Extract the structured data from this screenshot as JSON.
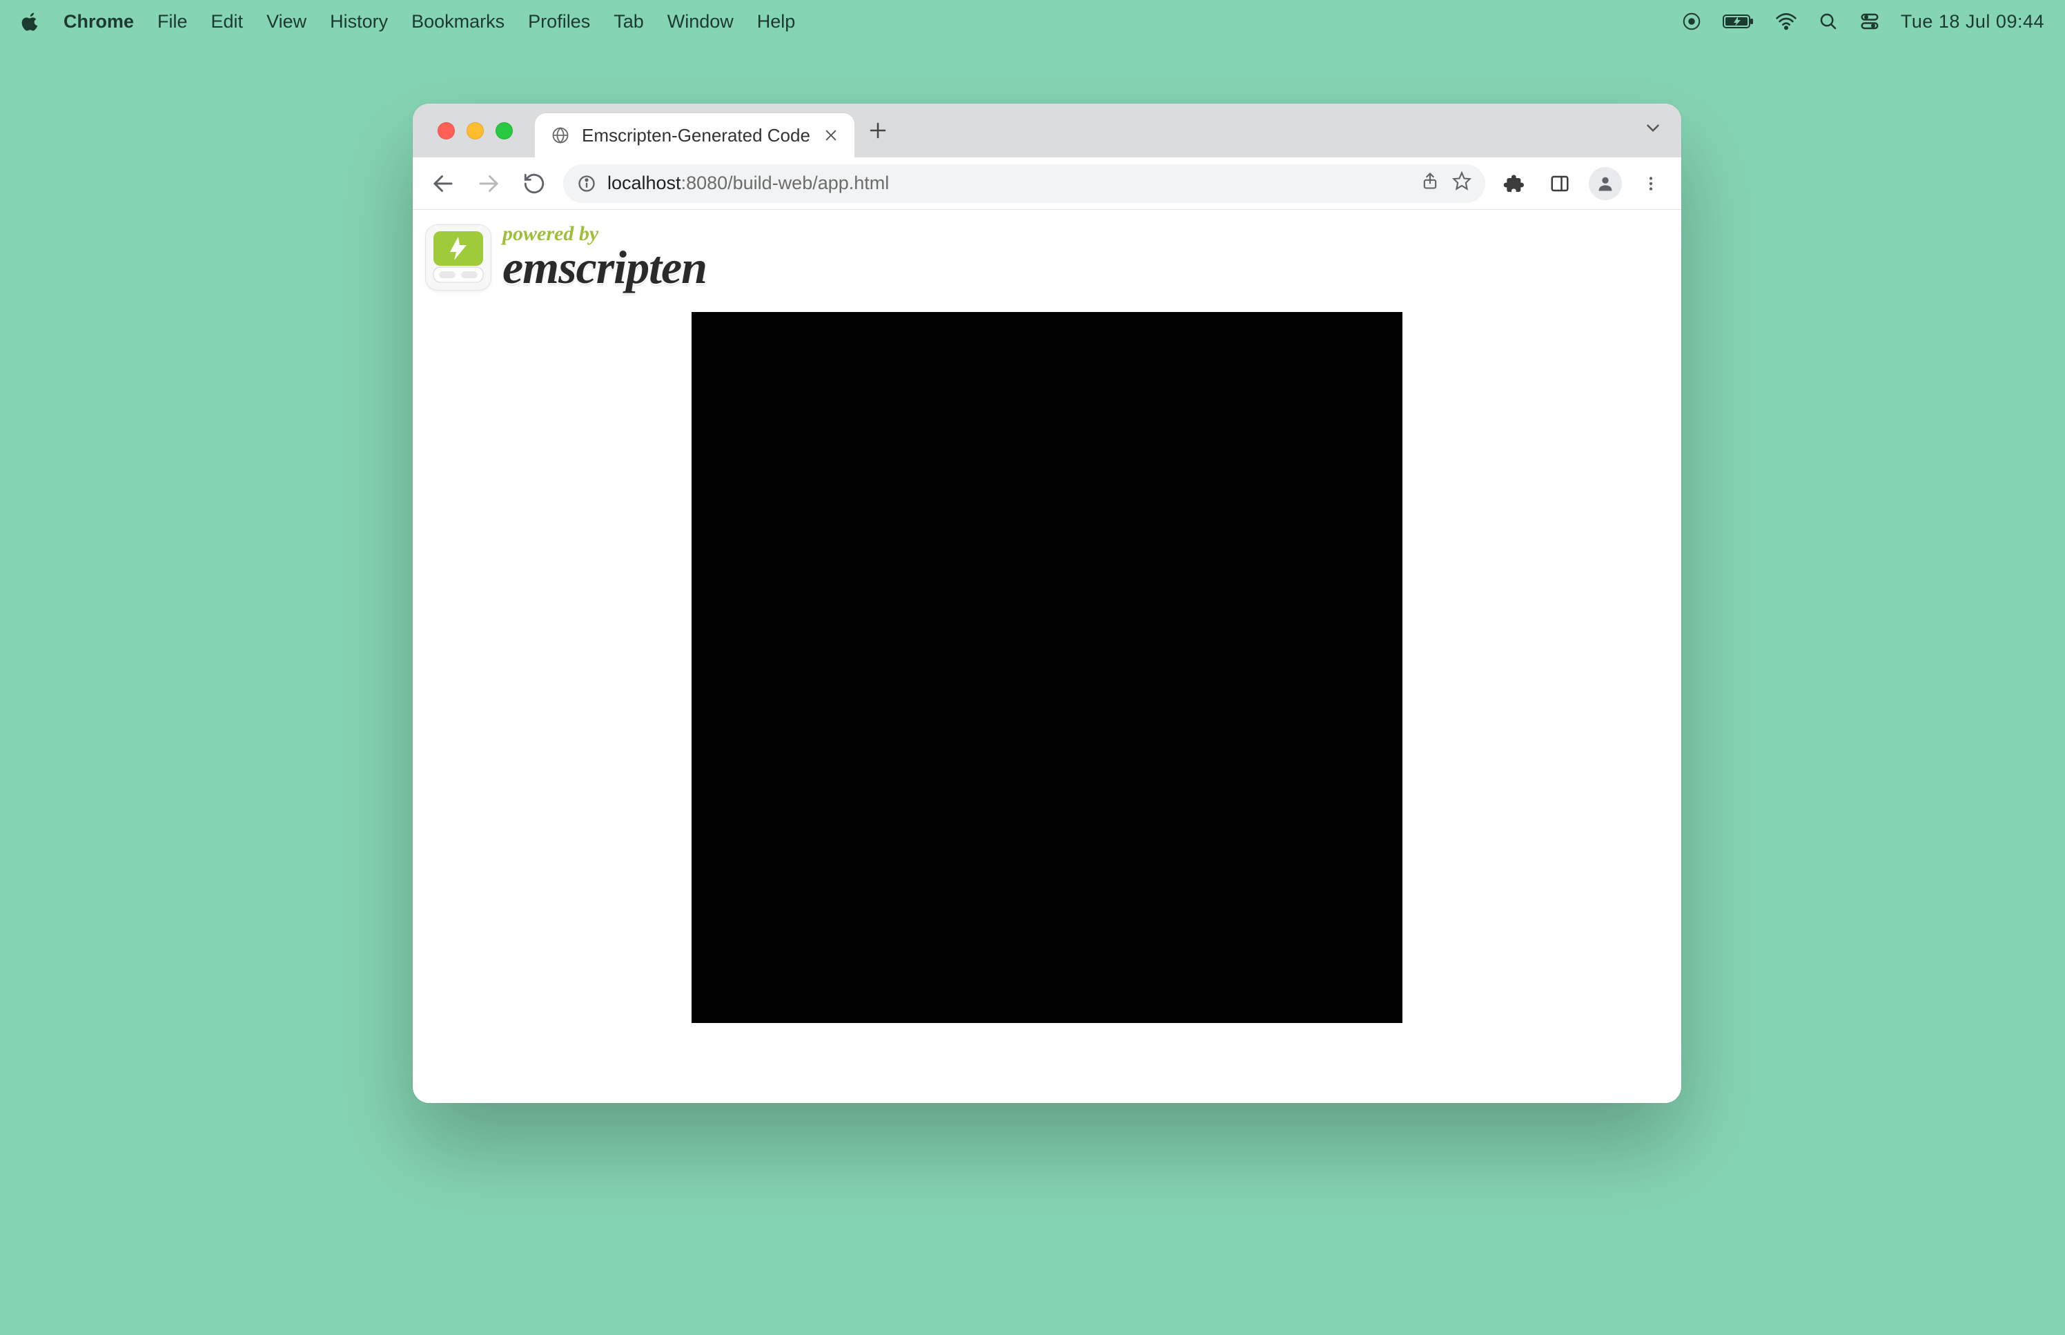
{
  "menubar": {
    "app_name": "Chrome",
    "items": [
      "File",
      "Edit",
      "View",
      "History",
      "Bookmarks",
      "Profiles",
      "Tab",
      "Window",
      "Help"
    ],
    "clock": "Tue 18 Jul  09:44"
  },
  "browser": {
    "tab": {
      "title": "Emscripten-Generated Code"
    },
    "url": {
      "host": "localhost",
      "port_path": ":8080/build-web/app.html"
    }
  },
  "page": {
    "powered_by": "powered by",
    "brand": "emscripten",
    "canvas": {
      "bg_color": "#000000",
      "triangle_color": "#ff0000"
    }
  }
}
